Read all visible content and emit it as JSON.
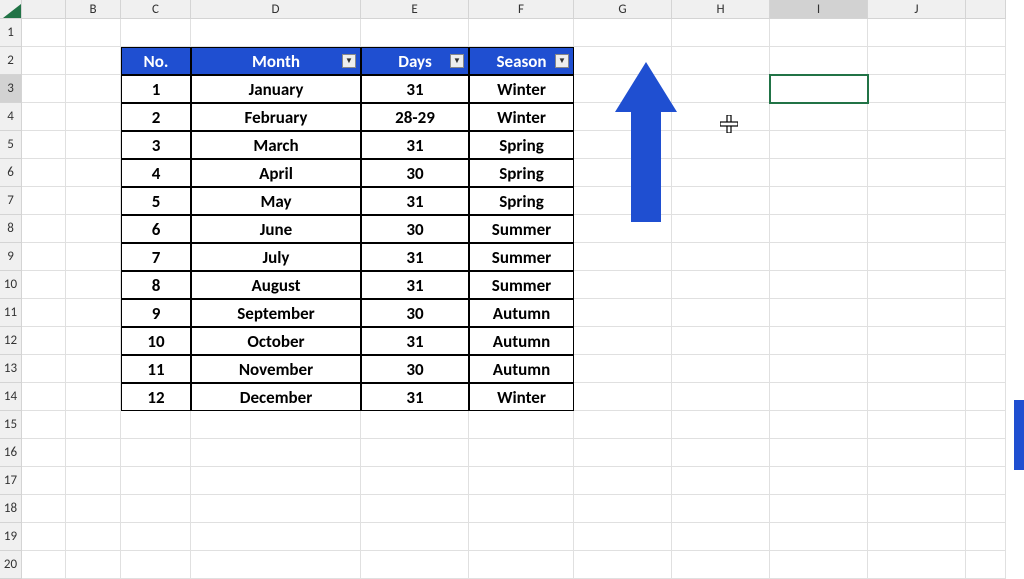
{
  "columns": [
    "",
    "B",
    "C",
    "D",
    "E",
    "F",
    "G",
    "H",
    "I",
    "J"
  ],
  "rows": [
    "1",
    "2",
    "3",
    "4",
    "5",
    "6",
    "7",
    "8",
    "9",
    "10",
    "11",
    "12",
    "13",
    "14",
    "15",
    "16",
    "17",
    "18",
    "19",
    "20"
  ],
  "active_cell": "I3",
  "table": {
    "headers": [
      "No.",
      "Month",
      "Days",
      "Season"
    ],
    "rows": [
      {
        "no": "1",
        "month": "January",
        "days": "31",
        "season": "Winter"
      },
      {
        "no": "2",
        "month": "February",
        "days": "28-29",
        "season": "Winter"
      },
      {
        "no": "3",
        "month": "March",
        "days": "31",
        "season": "Spring"
      },
      {
        "no": "4",
        "month": "April",
        "days": "30",
        "season": "Spring"
      },
      {
        "no": "5",
        "month": "May",
        "days": "31",
        "season": "Spring"
      },
      {
        "no": "6",
        "month": "June",
        "days": "30",
        "season": "Summer"
      },
      {
        "no": "7",
        "month": "July",
        "days": "31",
        "season": "Summer"
      },
      {
        "no": "8",
        "month": "August",
        "days": "31",
        "season": "Summer"
      },
      {
        "no": "9",
        "month": "September",
        "days": "30",
        "season": "Autumn"
      },
      {
        "no": "10",
        "month": "October",
        "days": "31",
        "season": "Autumn"
      },
      {
        "no": "11",
        "month": "November",
        "days": "30",
        "season": "Autumn"
      },
      {
        "no": "12",
        "month": "December",
        "days": "31",
        "season": "Winter"
      }
    ]
  },
  "annotation": {
    "type": "arrow",
    "direction": "up",
    "target": "Season filter"
  },
  "colors": {
    "header_bg": "#1f4fd1",
    "header_fg": "#ffffff",
    "grid_line": "#e0e0e0",
    "excel_green": "#217346"
  }
}
